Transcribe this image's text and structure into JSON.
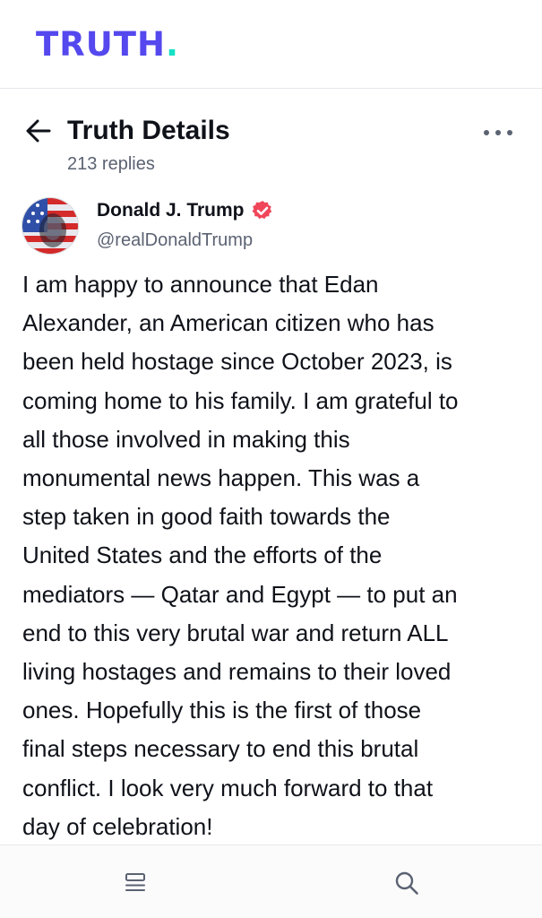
{
  "app": {
    "logo_text": "TRUTH",
    "logo_dot": ".",
    "colors": {
      "brand": "#5448ee",
      "accent": "#17e0c4",
      "verified": "#f0465a"
    }
  },
  "header": {
    "back_icon": "arrow-left-icon",
    "title": "Truth Details",
    "replies": "213 replies",
    "more_icon": "more-horizontal-icon"
  },
  "post": {
    "author_name": "Donald J. Trump",
    "author_handle": "@realDonaldTrump",
    "verified_icon": "verified-badge-icon",
    "lines": [
      "I am happy to announce that Edan",
      "Alexander, an American citizen who has",
      "been held hostage since October 2023, is",
      "coming home to his family. I am grateful to",
      "all those involved in making this",
      "monumental news happen. This was a",
      "step taken in good faith towards the",
      "United States and the efforts of the",
      "mediators — Qatar and Egypt — to put an",
      "end to this very brutal war and return ALL",
      "living hostages and remains to their loved",
      "ones. Hopefully this is the first of those",
      "final steps necessary to end this brutal",
      "conflict. I look very much forward to that",
      "day of celebration!"
    ]
  },
  "bottom_nav": {
    "items": [
      "feed-icon",
      "search-icon"
    ]
  }
}
